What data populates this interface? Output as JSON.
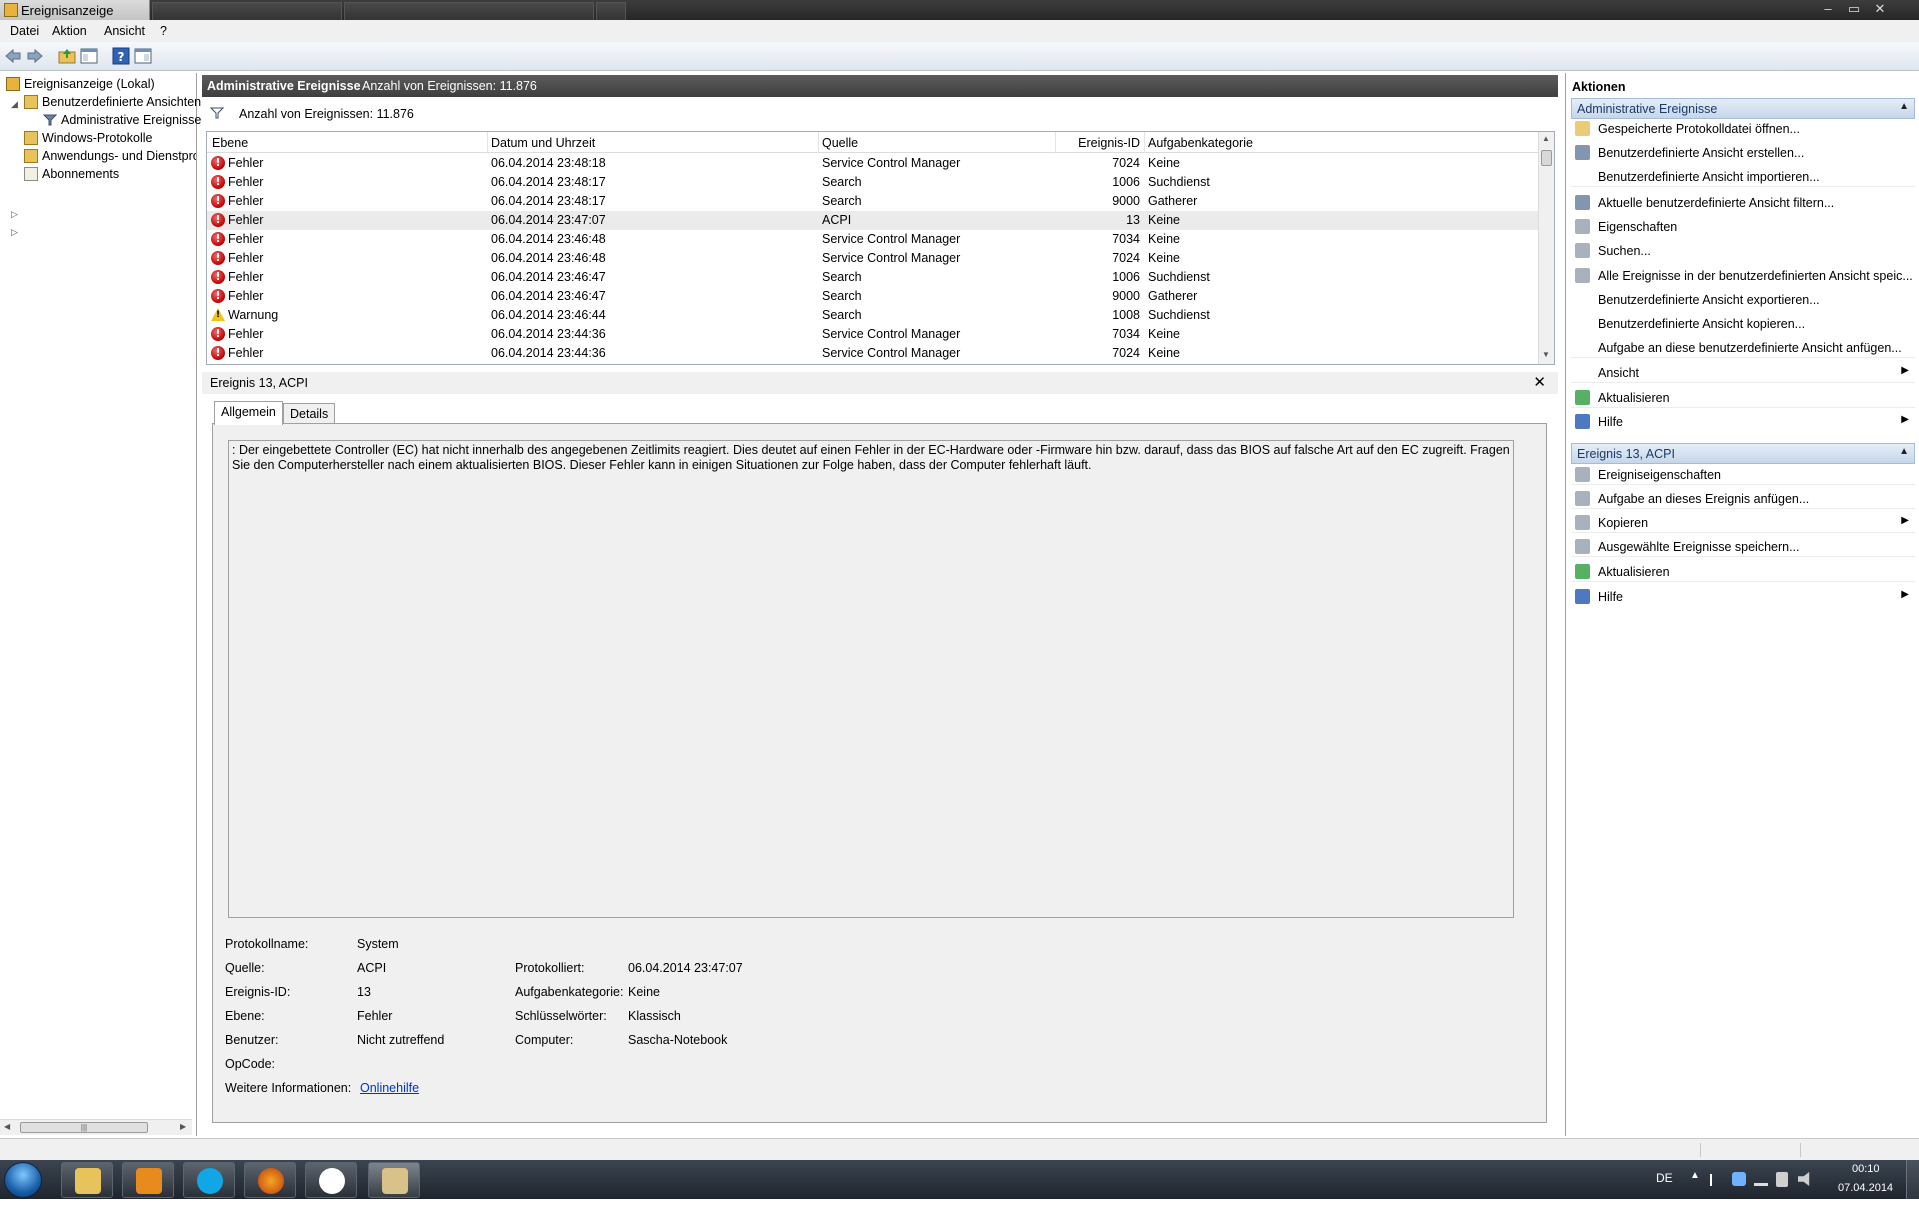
{
  "window": {
    "title": "Ereignisanzeige",
    "controls": {
      "minimize": "–",
      "maximize": "▭",
      "close": "✕"
    }
  },
  "menu": [
    "Datei",
    "Aktion",
    "Ansicht",
    "?"
  ],
  "tree": {
    "root": "Ereignisanzeige (Lokal)",
    "custom_views": "Benutzerdefinierte Ansichten",
    "admin_events": "Administrative Ereignisse",
    "windows_logs": "Windows-Protokolle",
    "app_logs": "Anwendungs- und Dienstprotokolle",
    "subscriptions": "Abonnements"
  },
  "center": {
    "header_title": "Administrative Ereignisse",
    "header_count": "Anzahl von Ereignissen: 11.876",
    "filter_count": "Anzahl von Ereignissen: 11.876",
    "columns": [
      "Ebene",
      "Datum und Uhrzeit",
      "Quelle",
      "Ereignis-ID",
      "Aufgabenkategorie"
    ],
    "rows": [
      {
        "level": "Fehler",
        "date": "06.04.2014 23:48:18",
        "source": "Service Control Manager",
        "id": "7024",
        "category": "Keine"
      },
      {
        "level": "Fehler",
        "date": "06.04.2014 23:48:17",
        "source": "Search",
        "id": "1006",
        "category": "Suchdienst"
      },
      {
        "level": "Fehler",
        "date": "06.04.2014 23:48:17",
        "source": "Search",
        "id": "9000",
        "category": "Gatherer"
      },
      {
        "level": "Fehler",
        "date": "06.04.2014 23:47:07",
        "source": "ACPI",
        "id": "13",
        "category": "Keine"
      },
      {
        "level": "Fehler",
        "date": "06.04.2014 23:46:48",
        "source": "Service Control Manager",
        "id": "7034",
        "category": "Keine"
      },
      {
        "level": "Fehler",
        "date": "06.04.2014 23:46:48",
        "source": "Service Control Manager",
        "id": "7024",
        "category": "Keine"
      },
      {
        "level": "Fehler",
        "date": "06.04.2014 23:46:47",
        "source": "Search",
        "id": "1006",
        "category": "Suchdienst"
      },
      {
        "level": "Fehler",
        "date": "06.04.2014 23:46:47",
        "source": "Search",
        "id": "9000",
        "category": "Gatherer"
      },
      {
        "level": "Warnung",
        "date": "06.04.2014 23:46:44",
        "source": "Search",
        "id": "1008",
        "category": "Suchdienst"
      },
      {
        "level": "Fehler",
        "date": "06.04.2014 23:44:36",
        "source": "Service Control Manager",
        "id": "7034",
        "category": "Keine"
      },
      {
        "level": "Fehler",
        "date": "06.04.2014 23:44:36",
        "source": "Service Control Manager",
        "id": "7024",
        "category": "Keine"
      }
    ]
  },
  "details": {
    "title": "Ereignis 13, ACPI",
    "close": "✕",
    "tabs": [
      "Allgemein",
      "Details"
    ],
    "message": ": Der eingebettete Controller (EC) hat nicht innerhalb des angegebenen Zeitlimits reagiert. Dies deutet auf einen Fehler in der EC-Hardware oder -Firmware hin bzw. darauf, dass das BIOS auf falsche Art auf den EC zugreift. Fragen Sie den Computerhersteller nach einem aktualisierten BIOS. Dieser Fehler kann in einigen Situationen zur Folge haben, dass der Computer fehlerhaft läuft.",
    "labels": {
      "log_name": "Protokollname:",
      "source": "Quelle:",
      "event_id": "Ereignis-ID:",
      "level": "Ebene:",
      "user": "Benutzer:",
      "opcode": "OpCode:",
      "more_info": "Weitere Informationen:",
      "logged": "Protokolliert:",
      "task_category": "Aufgabenkategorie:",
      "keywords": "Schlüsselwörter:",
      "computer": "Computer:"
    },
    "values": {
      "log_name": "System",
      "source": "ACPI",
      "event_id": "13",
      "level": "Fehler",
      "user": "Nicht zutreffend",
      "opcode": "",
      "more_info": "Onlinehilfe",
      "logged": "06.04.2014 23:47:07",
      "task_category": "Keine",
      "keywords": "Klassisch",
      "computer": "Sascha-Notebook"
    }
  },
  "actions": {
    "title": "Aktionen",
    "section1": "Administrative Ereignisse",
    "items1": [
      "Gespeicherte Protokolldatei öffnen...",
      "Benutzerdefinierte Ansicht erstellen...",
      "Benutzerdefinierte Ansicht importieren...",
      "Aktuelle benutzerdefinierte Ansicht filtern...",
      "Eigenschaften",
      "Suchen...",
      "Alle Ereignisse in der benutzerdefinierten Ansicht speic...",
      "Benutzerdefinierte Ansicht exportieren...",
      "Benutzerdefinierte Ansicht kopieren...",
      "Aufgabe an diese benutzerdefinierte Ansicht anfügen...",
      "Ansicht",
      "Aktualisieren",
      "Hilfe"
    ],
    "section2": "Ereignis 13, ACPI",
    "items2": [
      "Ereigniseigenschaften",
      "Aufgabe an dieses Ereignis anfügen...",
      "Kopieren",
      "Ausgewählte Ereignisse speichern...",
      "Aktualisieren",
      "Hilfe"
    ]
  },
  "taskbar": {
    "lang": "DE",
    "time": "00:10",
    "date": "07.04.2014"
  },
  "colors": {
    "error": "#c00000",
    "warning": "#f0c419",
    "section_bg": "#d6e3f3",
    "header_dark": "#4a4a4a",
    "link": "#0033cc"
  }
}
